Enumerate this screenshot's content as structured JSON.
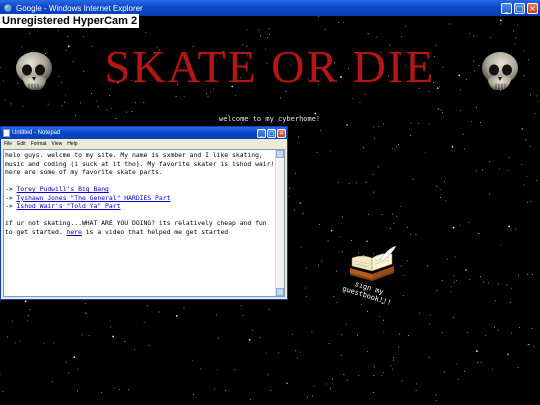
{
  "window": {
    "title": "Google - Windows Internet Explorer",
    "min": "_",
    "max": "□",
    "close": "×"
  },
  "watermark": "Unregistered HyperCam 2",
  "site": {
    "title": "SKATE OR DIE",
    "welcome": "welcome to my cyberhome!",
    "skull_icon": "skull-icon"
  },
  "notepad": {
    "title": "Untitled - Notepad",
    "menu": [
      "File",
      "Edit",
      "Format",
      "View",
      "Help"
    ],
    "intro": "helo guys. welcme to my site. My name is sxmber and I like skating, music and coding (i suck at it tho). My favorite skater is ishod wair! here are some of my favorite skate parts.",
    "links": [
      {
        "arrow": "-> ",
        "label": "Torey Pudwill's Big Bang"
      },
      {
        "arrow": "-> ",
        "label": "Tyshawn Jones \"The General\" HARDIES Part"
      },
      {
        "arrow": "-> ",
        "label": "Ishod Wair's \"Told Ya\" Part"
      }
    ],
    "outro_before": "if ur not skating...WHAT ARE YOU DOING? its relatively cheap and fun to get started. ",
    "outro_link": "here",
    "outro_after": " is a video that helped me get started"
  },
  "guestbook": {
    "label": "sign my guestbook!!!",
    "icon": "guestbook-icon"
  },
  "colors": {
    "title_red": "#b01818",
    "link_blue": "#0000cc",
    "xp_blue": "#0a47c8"
  }
}
